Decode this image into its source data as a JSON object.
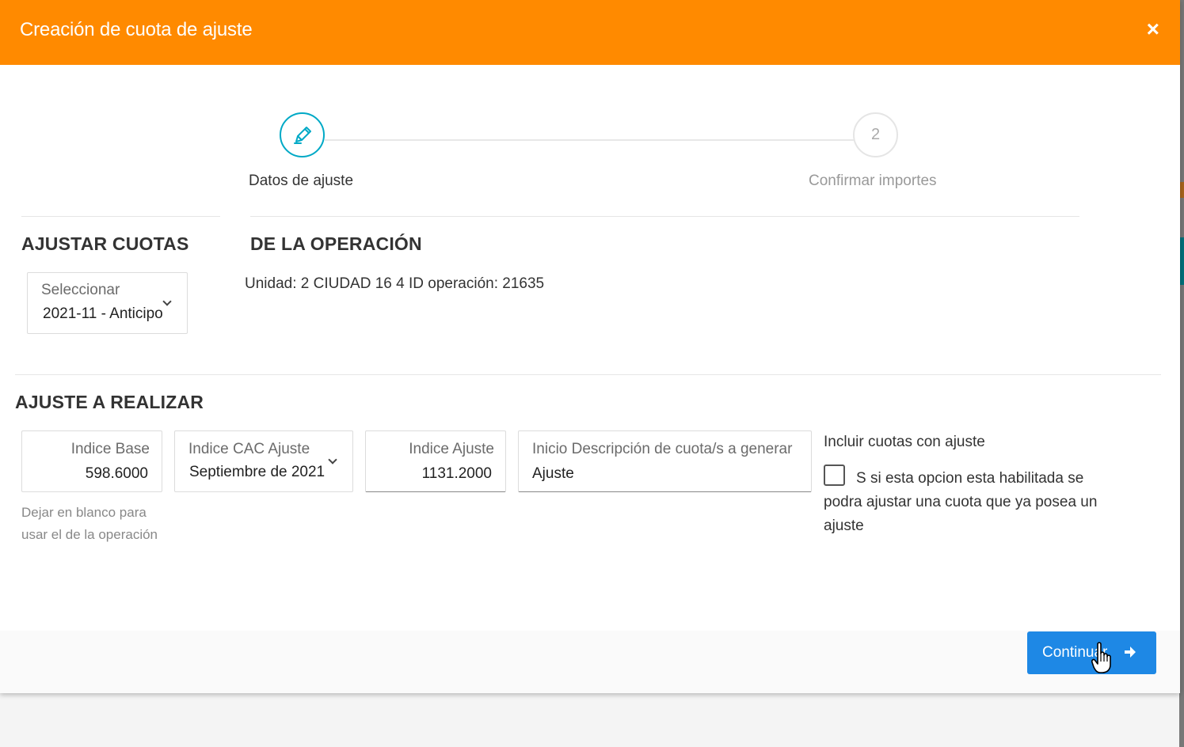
{
  "modal": {
    "title": "Creación de cuota de ajuste",
    "close_glyph": "×"
  },
  "stepper": {
    "steps": [
      {
        "label": "Datos de ajuste",
        "icon": "pencil-icon",
        "state": "active"
      },
      {
        "label": "Confirmar importes",
        "number": "2",
        "state": "pending"
      }
    ],
    "active_color": "#00a9c6"
  },
  "ajustar_cuotas": {
    "title": "AJUSTAR CUOTAS",
    "select": {
      "label": "Seleccionar",
      "value": "2021-11 - Anticipo"
    }
  },
  "operacion": {
    "title": "DE LA OPERACIÓN",
    "text": "Unidad: 2 CIUDAD 16 4 ID operación: 21635"
  },
  "ajuste": {
    "title": "AJUSTE A REALIZAR",
    "indice_base": {
      "label": "Indice Base",
      "value": "598.6000",
      "hint": "Dejar en blanco para usar el de la operación"
    },
    "indice_cac": {
      "label": "Indice CAC Ajuste",
      "value": "Septiembre de 2021"
    },
    "indice_ajuste": {
      "label": "Indice Ajuste",
      "value": "1131.2000"
    },
    "descripcion": {
      "label": "Inicio Descripción de cuota/s a generar",
      "value": "Ajuste"
    },
    "incluir": {
      "label": "Incluir cuotas con ajuste",
      "checked": false,
      "text": "S si esta opcion esta habilitada se podra ajustar una cuota que ya posea un ajuste"
    }
  },
  "footer": {
    "continue_label": "Continuar",
    "accent": "#1e88e5"
  },
  "colors": {
    "header": "#ff8a00"
  }
}
